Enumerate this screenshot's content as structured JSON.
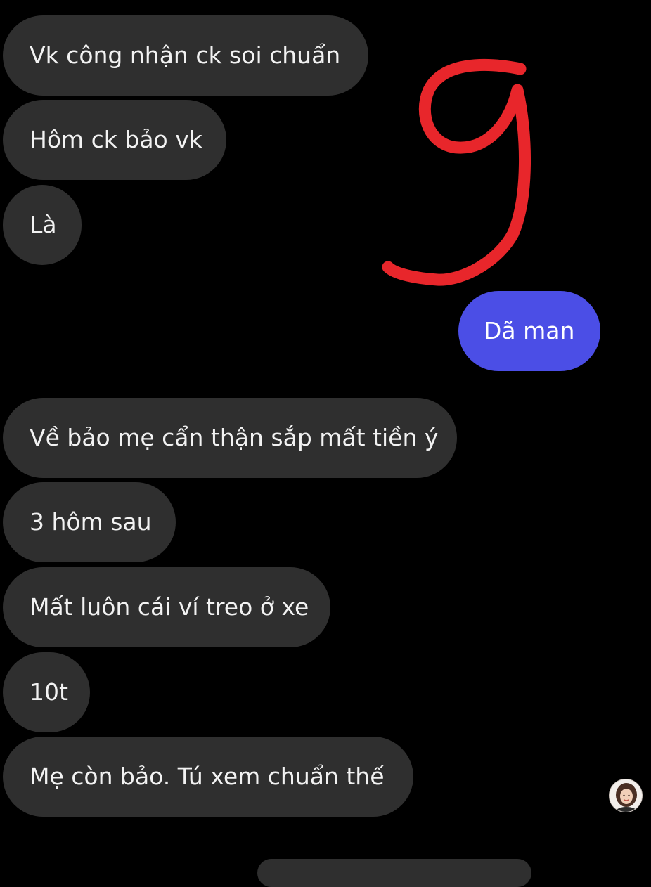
{
  "conversation": {
    "incoming_top": [
      {
        "text": "Vk công nhận ck soi chuẩn"
      },
      {
        "text": "Hôm ck bảo vk"
      },
      {
        "text": "Là"
      }
    ],
    "outgoing": [
      {
        "text": "Dã man"
      }
    ],
    "incoming_bottom": [
      {
        "text": "Về bảo mẹ cẩn thận sắp mất tiền ý"
      },
      {
        "text": "3 hôm sau"
      },
      {
        "text": "Mất luôn cái ví treo ở xe"
      },
      {
        "text": "10t"
      },
      {
        "text": "Mẹ còn bảo. Tú xem chuẩn thế"
      }
    ]
  },
  "annotation": {
    "glyph": "9",
    "color": "#e8262b"
  },
  "colors": {
    "background": "#000000",
    "incoming_bubble": "#2f2f2f",
    "outgoing_bubble": "#4b4ee6",
    "text": "#f2f2f2"
  },
  "icons": {
    "avatar": "user-avatar-icon"
  }
}
